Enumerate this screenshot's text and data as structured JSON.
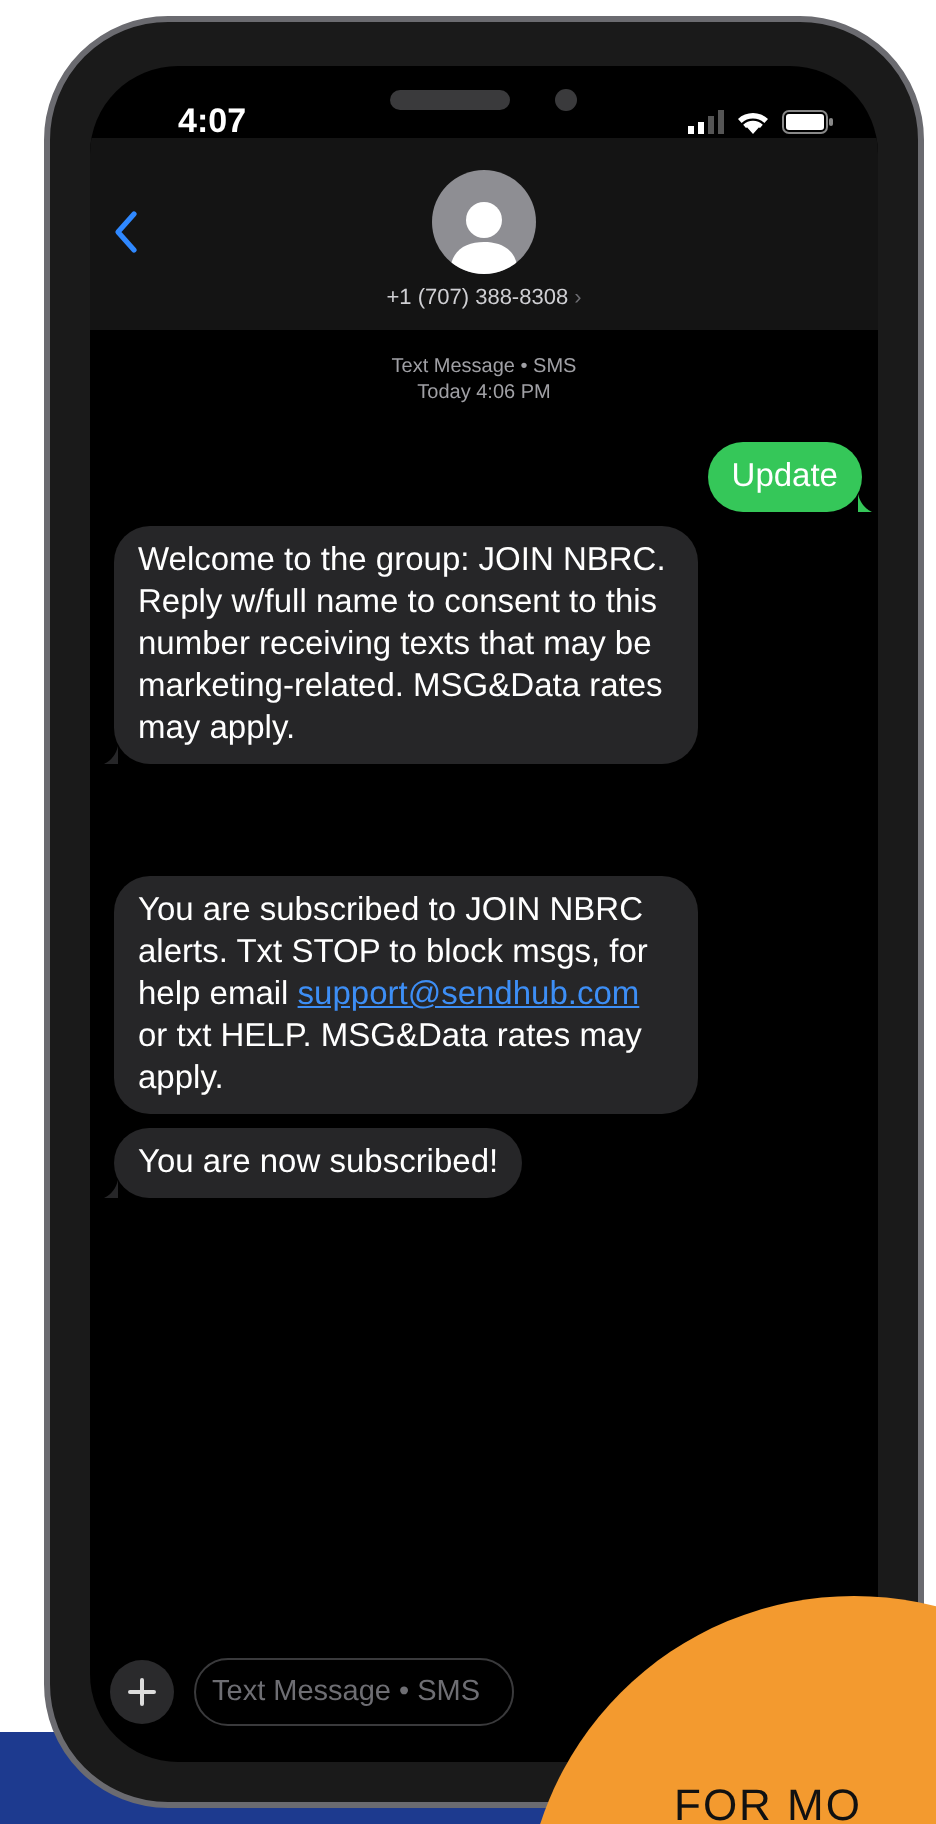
{
  "status_bar": {
    "time": "4:07"
  },
  "contact": {
    "number": "+1 (707) 388-8308",
    "chevron": "›"
  },
  "thread_info": {
    "service": "Text Message • SMS",
    "timestamp": "Today 4:06 PM"
  },
  "messages": [
    {
      "kind": "sent",
      "text": "Update",
      "tail": true
    },
    {
      "kind": "received",
      "text": "Welcome to the group: JOIN NBRC. Reply w/full name to consent to this number receiving texts that may be marketing-related. MSG&Data rates may apply.",
      "tail": true
    },
    {
      "kind": "received",
      "text": "You are subscribed to JOIN NBRC alerts. Txt STOP to block msgs, for help email ",
      "link": "support@sendhub.com",
      "text_after": " or txt HELP. MSG&Data rates may apply.",
      "tail": false
    },
    {
      "kind": "received",
      "text": "You are now subscribed!",
      "tail": true
    }
  ],
  "composer": {
    "placeholder": "Text Message • SMS"
  },
  "promo": {
    "text": "FOR MO"
  }
}
